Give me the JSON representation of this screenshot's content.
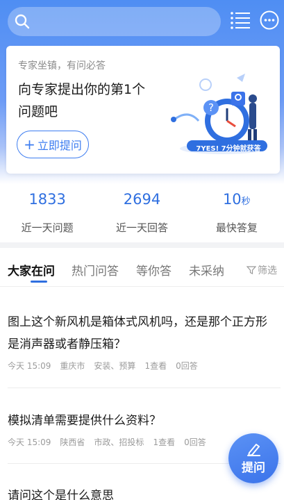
{
  "header": {
    "search_icon": "search-icon",
    "menu_icon": "list-icon",
    "chat_icon": "chat-bubble-icon"
  },
  "ask_card": {
    "subtitle": "专家坐镇，有问必答",
    "title_line1": "向专家提出你的第1个",
    "title_line2": "问题吧",
    "button_label": "立即提问",
    "badge_text": "7YES! 7分钟就获答"
  },
  "stats": [
    {
      "value": "1833",
      "unit": "",
      "label": "近一天问题"
    },
    {
      "value": "2694",
      "unit": "",
      "label": "近一天回答"
    },
    {
      "value": "10",
      "unit": "秒",
      "label": "最快答复"
    }
  ],
  "tabs": [
    {
      "label": "大家在问",
      "active": true
    },
    {
      "label": "热门问答",
      "active": false
    },
    {
      "label": "等你答",
      "active": false
    },
    {
      "label": "未采纳",
      "active": false
    }
  ],
  "filter_label": "筛选",
  "questions": [
    {
      "title": "图上这个新风机是箱体式风机吗，还是那个正方形是消声器或者静压箱？",
      "time": "今天 15:09",
      "city": "重庆市",
      "category": "安装、预算",
      "views": "1查看",
      "answers": "0回答"
    },
    {
      "title": "模拟清单需要提供什么资料？",
      "time": "今天 15:09",
      "city": "陕西省",
      "category": "市政、招投标",
      "views": "1查看",
      "answers": "0回答"
    },
    {
      "title": "请问这个是什么意思"
    }
  ],
  "fab": {
    "label": "提问",
    "icon": "pencil-icon"
  },
  "colors": {
    "accent": "#2f6fe0",
    "header_gradient_top": "#4f8ef3"
  }
}
